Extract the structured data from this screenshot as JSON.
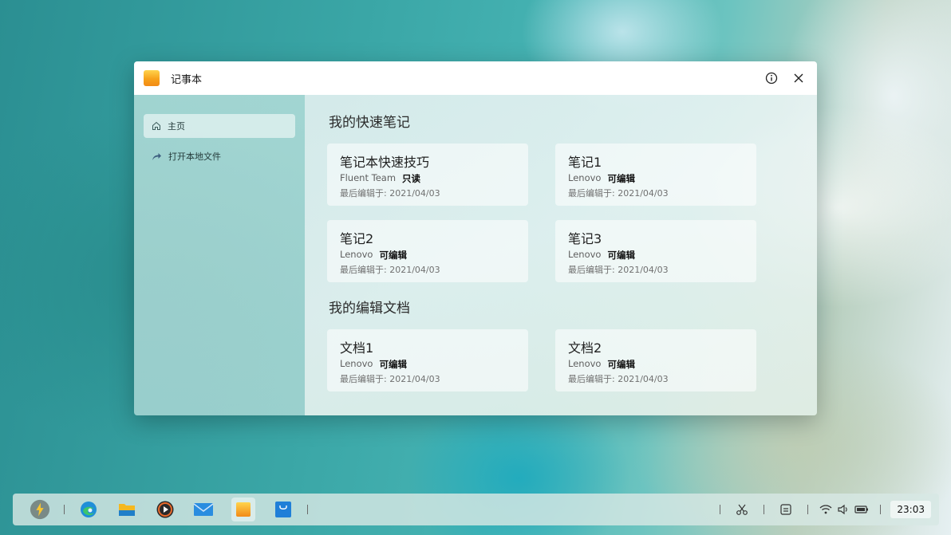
{
  "window": {
    "title": "记事本"
  },
  "sidebar": {
    "items": [
      {
        "label": "主页",
        "icon": "home-icon",
        "active": true
      },
      {
        "label": "打开本地文件",
        "icon": "share-arrow-icon",
        "active": false
      }
    ]
  },
  "sections": [
    {
      "title": "我的快速笔记",
      "cards": [
        {
          "title": "笔记本快速技巧",
          "author": "Fluent Team",
          "permission": "只读",
          "date": "最后编辑于: 2021/04/03"
        },
        {
          "title": "笔记1",
          "author": "Lenovo",
          "permission": "可编辑",
          "date": "最后编辑于: 2021/04/03"
        },
        {
          "title": "笔记2",
          "author": "Lenovo",
          "permission": "可编辑",
          "date": "最后编辑于: 2021/04/03"
        },
        {
          "title": "笔记3",
          "author": "Lenovo",
          "permission": "可编辑",
          "date": "最后编辑于: 2021/04/03"
        }
      ]
    },
    {
      "title": "我的编辑文档",
      "cards": [
        {
          "title": "文档1",
          "author": "Lenovo",
          "permission": "可编辑",
          "date": "最后编辑于: 2021/04/03"
        },
        {
          "title": "文档2",
          "author": "Lenovo",
          "permission": "可编辑",
          "date": "最后编辑于: 2021/04/03"
        }
      ]
    }
  ],
  "taskbar": {
    "apps": [
      "launcher-icon",
      "edge-browser-icon",
      "file-manager-icon",
      "media-player-icon",
      "mail-icon",
      "notepad-icon",
      "store-icon"
    ],
    "clock": "23:03"
  },
  "colors": {
    "accent": "#f7a21b",
    "sidebar_bg": "#b4deda"
  }
}
